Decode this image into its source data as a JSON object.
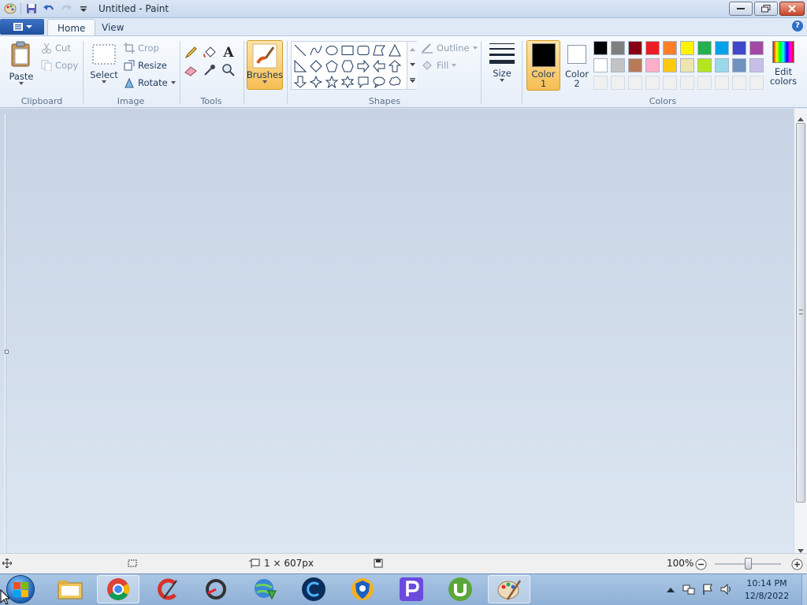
{
  "window": {
    "title": "Untitled - Paint"
  },
  "tabs": {
    "home": "Home",
    "view": "View"
  },
  "ribbon": {
    "clipboard": {
      "paste": "Paste",
      "cut": "Cut",
      "copy": "Copy",
      "label": "Clipboard"
    },
    "image": {
      "select": "Select",
      "crop": "Crop",
      "resize": "Resize",
      "rotate": "Rotate",
      "label": "Image"
    },
    "tools": {
      "label": "Tools"
    },
    "brushes": {
      "label": "Brushes"
    },
    "shapes": {
      "outline": "Outline",
      "fill": "Fill",
      "label": "Shapes"
    },
    "size": {
      "label": "Size"
    },
    "colors": {
      "color1": "Color 1",
      "color1_line1": "Color",
      "color1_line2": "1",
      "color2": "Color 2",
      "color2_line1": "Color",
      "color2_line2": "2",
      "edit": "Edit colors",
      "edit_line1": "Edit",
      "edit_line2": "colors",
      "label": "Colors",
      "color1_value": "#000000",
      "color2_value": "#ffffff",
      "palette_row1": [
        "#000000",
        "#7f7f7f",
        "#880015",
        "#ed1c24",
        "#ff7f27",
        "#fff200",
        "#22b14c",
        "#00a2e8",
        "#3f48cc",
        "#a349a4"
      ],
      "palette_row2": [
        "#ffffff",
        "#c3c3c3",
        "#b97a57",
        "#ffaec9",
        "#ffc90e",
        "#efe4b0",
        "#b5e61d",
        "#99d9ea",
        "#7092be",
        "#c8bfe7"
      ],
      "palette_row3": [
        "#f0f0f0",
        "#f0f0f0",
        "#f0f0f0",
        "#f0f0f0",
        "#f0f0f0",
        "#f0f0f0",
        "#f0f0f0",
        "#f0f0f0",
        "#f0f0f0",
        "#f0f0f0"
      ]
    }
  },
  "status": {
    "canvas_size": "1 × 607px",
    "zoom": "100%"
  },
  "taskbar": {
    "time": "10:14 PM",
    "date": "12/8/2022"
  }
}
